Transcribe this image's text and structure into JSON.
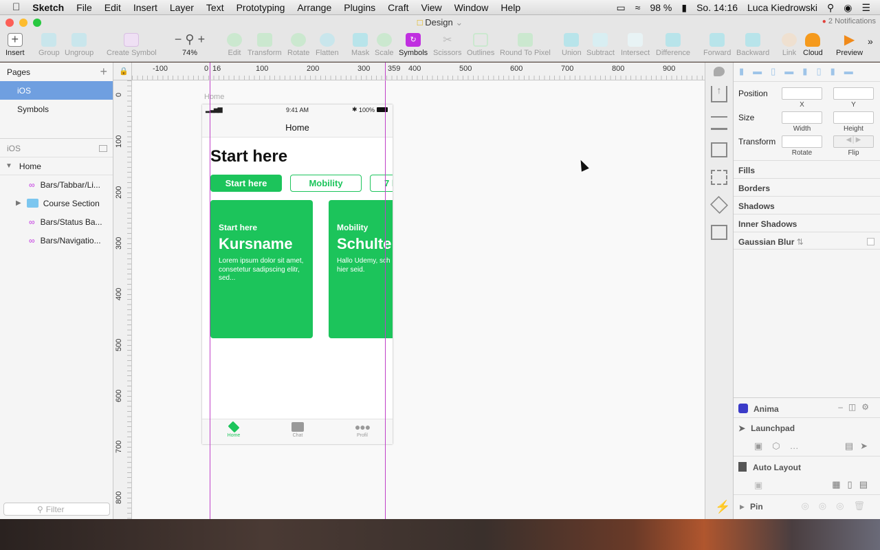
{
  "menubar": {
    "app": "Sketch",
    "items": [
      "File",
      "Edit",
      "Insert",
      "Layer",
      "Text",
      "Prototyping",
      "Arrange",
      "Plugins",
      "Craft",
      "View",
      "Window",
      "Help"
    ],
    "battery": "98 %",
    "clock": "So. 14:16",
    "user": "Luca Kiedrowski"
  },
  "window": {
    "title": "Design",
    "notifications": "2 Notifications"
  },
  "toolbar": {
    "insert": "Insert",
    "group": "Group",
    "ungroup": "Ungroup",
    "create_symbol": "Create Symbol",
    "zoom": "74%",
    "edit": "Edit",
    "transform": "Transform",
    "rotate": "Rotate",
    "flatten": "Flatten",
    "mask": "Mask",
    "scale": "Scale",
    "symbols": "Symbols",
    "scissors": "Scissors",
    "outlines": "Outlines",
    "round_to_pixel": "Round To Pixel",
    "union": "Union",
    "subtract": "Subtract",
    "intersect": "Intersect",
    "difference": "Difference",
    "forward": "Forward",
    "backward": "Backward",
    "link": "Link",
    "cloud": "Cloud",
    "preview": "Preview"
  },
  "left_panel": {
    "pages_title": "Pages",
    "pages": [
      "iOS",
      "Symbols"
    ],
    "layers_title": "iOS",
    "layers": [
      {
        "label": "Home"
      },
      {
        "label": "Bars/Tabbar/Li..."
      },
      {
        "label": "Course Section"
      },
      {
        "label": "Bars/Status Ba..."
      },
      {
        "label": "Bars/Navigatio..."
      }
    ],
    "filter_placeholder": "Filter"
  },
  "ruler": {
    "h_labels": [
      "-100",
      "0",
      "16",
      "100",
      "200",
      "300",
      "359",
      "400",
      "500",
      "600",
      "700",
      "800",
      "900"
    ],
    "v_labels": [
      "0",
      "100",
      "200",
      "300",
      "400",
      "500",
      "600",
      "700",
      "800"
    ]
  },
  "artboard": {
    "name": "Home",
    "status_time": "9:41 AM",
    "battery": "100%",
    "nav_title": "Home",
    "heading": "Start here",
    "chips": [
      "Start here",
      "Mobility",
      "7 l"
    ],
    "cards": [
      {
        "kicker": "Start here",
        "title": "Kursname",
        "body": "Lorem ipsum dolor sit amet, consetetur sadipscing elitr, sed..."
      },
      {
        "kicker": "Mobility",
        "title": "Schulte",
        "body": "Hallo Udemy, sch ihr hier seid."
      }
    ],
    "tabs": [
      "Home",
      "Chat",
      "Profil"
    ]
  },
  "inspector": {
    "position": "Position",
    "x": "X",
    "y": "Y",
    "size": "Size",
    "width": "Width",
    "height": "Height",
    "transform": "Transform",
    "rotate": "Rotate",
    "flip": "Flip",
    "sections": [
      "Fills",
      "Borders",
      "Shadows",
      "Inner Shadows",
      "Gaussian Blur"
    ],
    "plugins": [
      "Anima",
      "Launchpad",
      "Auto Layout",
      "Pin"
    ]
  },
  "colors": {
    "accent_green": "#1cc45b",
    "guide": "#c040c8",
    "selected_page": "#6f9fe0",
    "symbols_purple": "#c02fe0"
  }
}
